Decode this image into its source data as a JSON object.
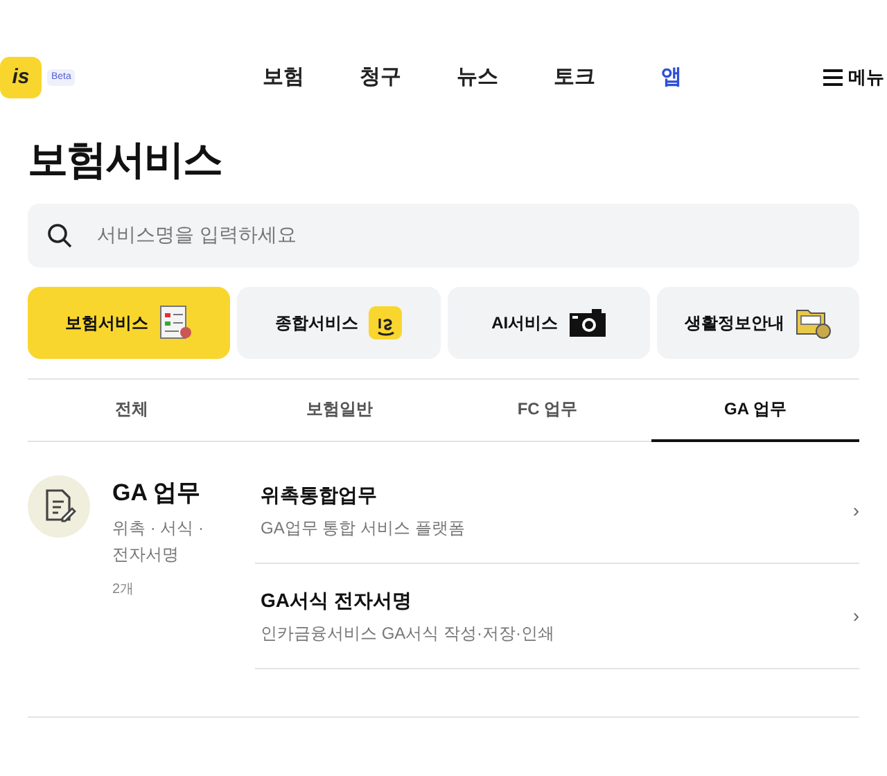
{
  "header": {
    "logo": "is",
    "badge": "Beta",
    "nav": [
      {
        "label": "보험",
        "selected": false
      },
      {
        "label": "청구",
        "selected": false
      },
      {
        "label": "뉴스",
        "selected": false
      },
      {
        "label": "토크",
        "selected": false
      },
      {
        "label": "앱",
        "selected": true
      }
    ],
    "menu": "메뉴"
  },
  "title": "보험서비스",
  "search": {
    "placeholder": "서비스명을 입력하세요"
  },
  "categories": [
    {
      "label": "보험서비스",
      "kind": "document",
      "selected": true
    },
    {
      "label": "종합서비스",
      "kind": "logo",
      "selected": false
    },
    {
      "label": "AI서비스",
      "kind": "camera",
      "selected": false
    },
    {
      "label": "생활정보안내",
      "kind": "folder",
      "selected": false
    }
  ],
  "tabs": [
    {
      "label": "전체",
      "selected": false
    },
    {
      "label": "보험일반",
      "selected": false
    },
    {
      "label": "FC 업무",
      "selected": false
    },
    {
      "label": "GA 업무",
      "selected": true
    }
  ],
  "section": {
    "title": "GA 업무",
    "description": "위촉 · 서식 · 전자서명",
    "count": "2개",
    "items": [
      {
        "title": "위촉통합업무",
        "subtitle": "GA업무 통합 서비스 플랫폼",
        "chevron": "›"
      },
      {
        "title": "GA서식 전자서명",
        "subtitle": "인카금융서비스 GA서식 작성·저장·인쇄",
        "chevron": "›"
      }
    ]
  }
}
